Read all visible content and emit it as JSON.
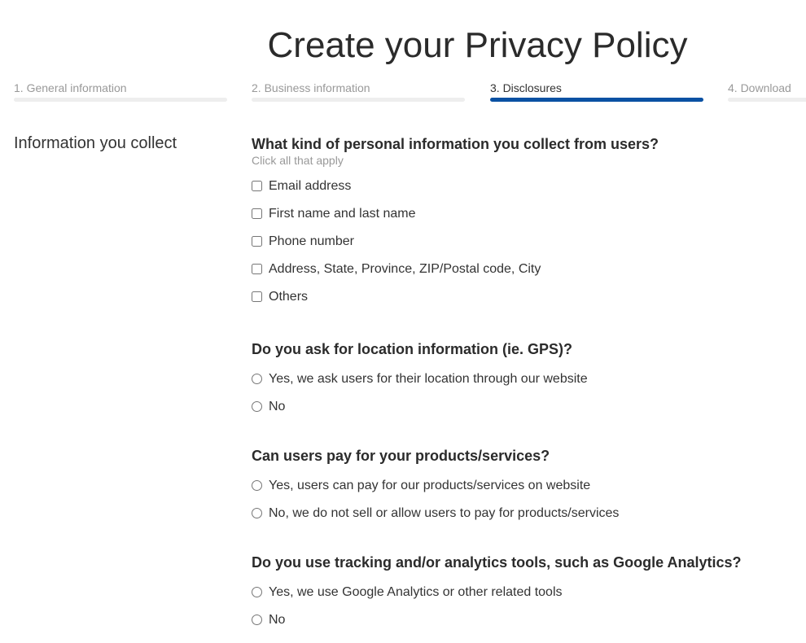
{
  "page": {
    "title": "Create your Privacy Policy"
  },
  "steps": [
    {
      "label": "1. General information",
      "active": false
    },
    {
      "label": "2. Business information",
      "active": false
    },
    {
      "label": "3. Disclosures",
      "active": true
    },
    {
      "label": "4. Download",
      "active": false
    }
  ],
  "colors": {
    "active_step": "#0a51a3",
    "inactive_step": "#eeeeee"
  },
  "section": {
    "label": "Information you collect"
  },
  "questions": [
    {
      "title": "What kind of personal information you collect from users?",
      "hint": "Click all that apply",
      "type": "checkbox",
      "options": [
        {
          "label": "Email address",
          "checked": false
        },
        {
          "label": "First name and last name",
          "checked": false
        },
        {
          "label": "Phone number",
          "checked": false
        },
        {
          "label": "Address, State, Province, ZIP/Postal code, City",
          "checked": false
        },
        {
          "label": "Others",
          "checked": false
        }
      ]
    },
    {
      "title": "Do you ask for location information (ie. GPS)?",
      "type": "radio",
      "options": [
        {
          "label": "Yes, we ask users for their location through our website",
          "checked": false
        },
        {
          "label": "No",
          "checked": false
        }
      ]
    },
    {
      "title": "Can users pay for your products/services?",
      "type": "radio",
      "options": [
        {
          "label": "Yes, users can pay for our products/services on website",
          "checked": false
        },
        {
          "label": "No, we do not sell or allow users to pay for products/services",
          "checked": false
        }
      ]
    },
    {
      "title": "Do you use tracking and/or analytics tools, such as Google Analytics?",
      "type": "radio",
      "options": [
        {
          "label": "Yes, we use Google Analytics or other related tools",
          "checked": false
        },
        {
          "label": "No",
          "checked": false
        }
      ]
    }
  ]
}
